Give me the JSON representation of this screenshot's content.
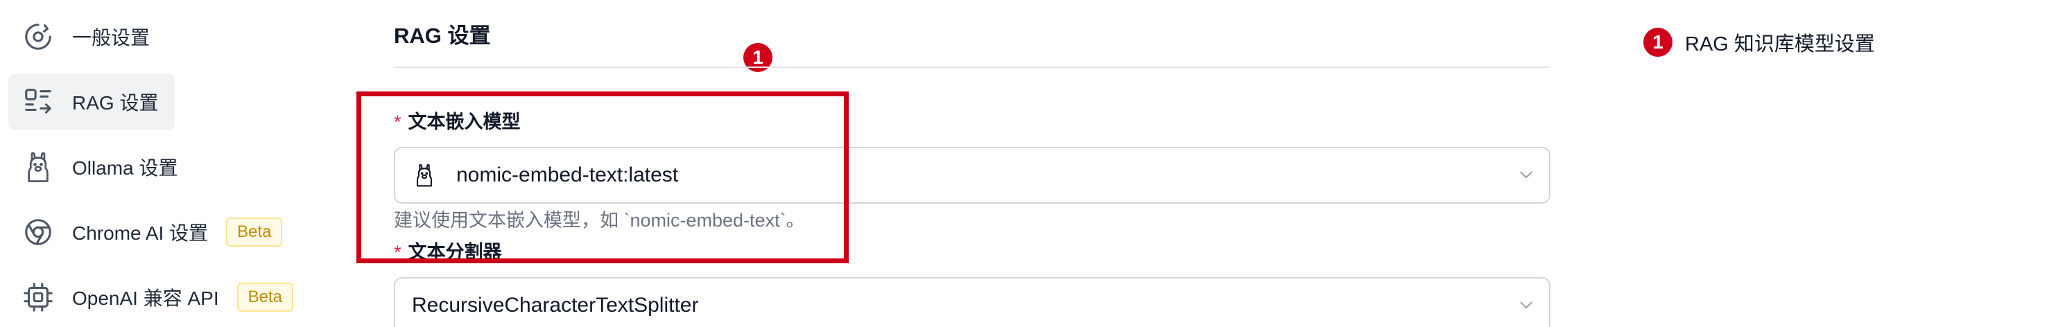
{
  "sidebar": {
    "items": [
      {
        "label": "一般设置",
        "icon": "gear-icon",
        "active": false
      },
      {
        "label": "RAG 设置",
        "icon": "rag-icon",
        "active": true
      },
      {
        "label": "Ollama 设置",
        "icon": "llama-icon",
        "active": false
      },
      {
        "label": "Chrome AI 设置",
        "icon": "chrome-icon",
        "active": false,
        "badge": "Beta"
      },
      {
        "label": "OpenAI 兼容 API",
        "icon": "chip-icon",
        "active": false,
        "badge": "Beta"
      }
    ]
  },
  "main": {
    "title": "RAG 设置",
    "marker": "1",
    "fields": [
      {
        "required_mark": "*",
        "label": "文本嵌入模型",
        "value": "nomic-embed-text:latest",
        "value_icon": "llama-icon",
        "help": "建议使用文本嵌入模型，如 `nomic-embed-text`。"
      },
      {
        "required_mark": "*",
        "label": "文本分割器",
        "value": "RecursiveCharacterTextSplitter"
      }
    ]
  },
  "annotation": {
    "marker": "1",
    "text": "RAG 知识库模型设置"
  },
  "colors": {
    "accent_red": "#cc0016",
    "marker_red": "#d0021b",
    "active_bg": "#f1f2f4",
    "beta_text": "#c08a00",
    "beta_bg": "#fffbe6"
  }
}
